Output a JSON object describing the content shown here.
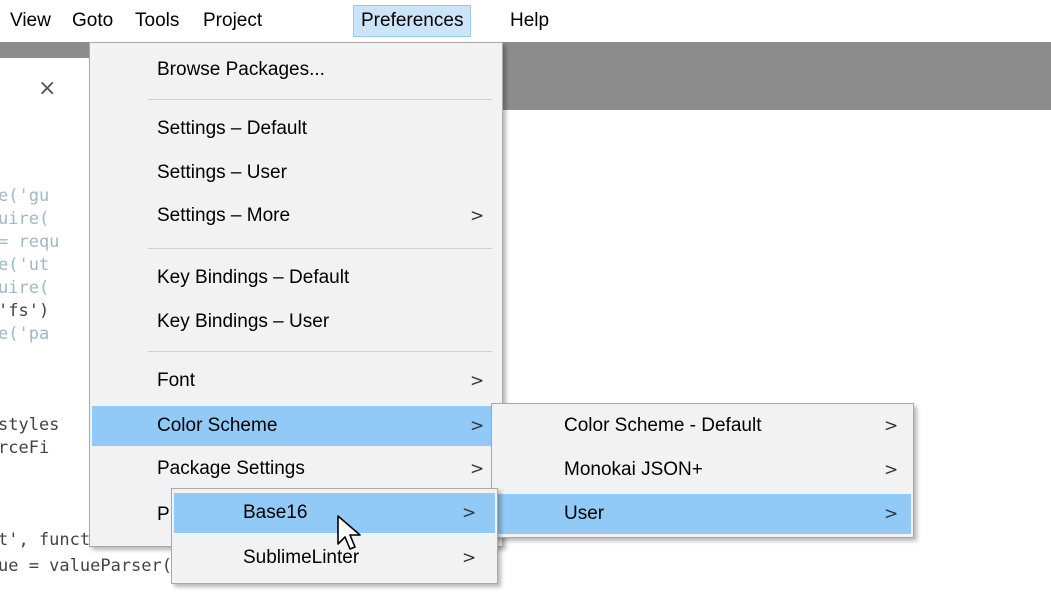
{
  "menubar": {
    "items": [
      "View",
      "Goto",
      "Tools",
      "Project",
      "Preferences",
      "Help"
    ],
    "active": "Preferences"
  },
  "tab": {
    "close_glyph": "×"
  },
  "code": {
    "lines": [
      "e('gu",
      "uire(",
      "= requ",
      "e('ut",
      "uire(",
      "'fs')",
      "e('pa",
      "",
      "styles",
      "rceFi",
      "",
      "t', functio",
      "ue = valueParser(sourceFile);"
    ]
  },
  "preferences_menu": {
    "browse": "Browse Packages...",
    "settings_default": "Settings – Default",
    "settings_user": "Settings – User",
    "settings_more": "Settings – More",
    "key_default": "Key Bindings – Default",
    "key_user": "Key Bindings – User",
    "font": "Font",
    "color_scheme": "Color Scheme",
    "package_settings": "Package Settings",
    "p_partial": "P"
  },
  "color_scheme_menu": {
    "default": "Color Scheme - Default",
    "monokai": "Monokai JSON+",
    "user": "User"
  },
  "package_menu": {
    "base16": "Base16",
    "sublimelinter": "SublimeLinter"
  },
  "arrow_glyph": ">",
  "colors": {
    "highlight": "#91c9f7",
    "menubar_active": "#cce4f7",
    "tabbar": "#8c8c8c",
    "menu_bg": "#f2f2f2"
  }
}
